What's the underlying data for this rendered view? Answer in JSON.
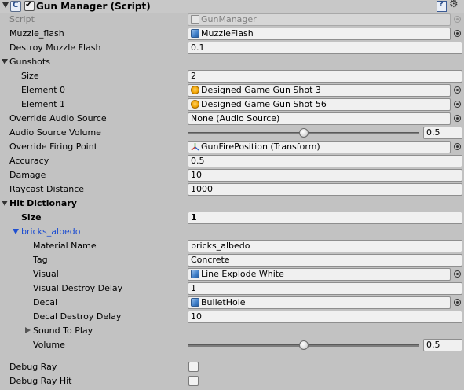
{
  "component": {
    "title": "Gun Manager (Script)"
  },
  "fields": {
    "script": {
      "label": "Script",
      "value": "GunManager"
    },
    "muzzle_flash": {
      "label": "Muzzle_flash",
      "value": "MuzzleFlash"
    },
    "destroy_muzzle_flash": {
      "label": "Destroy Muzzle Flash",
      "value": "0.1"
    },
    "gunshots": {
      "label": "Gunshots",
      "size_label": "Size",
      "size_value": "2",
      "elements": [
        {
          "label": "Element 0",
          "value": "Designed Game Gun Shot 3"
        },
        {
          "label": "Element 1",
          "value": "Designed Game Gun Shot 56"
        }
      ]
    },
    "override_audio_source": {
      "label": "Override Audio Source",
      "value": "None (Audio Source)"
    },
    "audio_source_volume": {
      "label": "Audio Source Volume",
      "value": "0.5",
      "level": 0.5
    },
    "override_firing_point": {
      "label": "Override Firing Point",
      "value": "GunFirePosition (Transform)"
    },
    "accuracy": {
      "label": "Accuracy",
      "value": "0.5"
    },
    "damage": {
      "label": "Damage",
      "value": "10"
    },
    "raycast_distance": {
      "label": "Raycast Distance",
      "value": "1000"
    },
    "hit_dictionary": {
      "label": "Hit Dictionary",
      "size_label": "Size",
      "size_value": "1",
      "entry": {
        "label": "bricks_albedo",
        "material_name": {
          "label": "Material Name",
          "value": "bricks_albedo"
        },
        "tag": {
          "label": "Tag",
          "value": "Concrete"
        },
        "visual": {
          "label": "Visual",
          "value": "Line Explode White"
        },
        "visual_destroy_delay": {
          "label": "Visual Destroy Delay",
          "value": "1"
        },
        "decal": {
          "label": "Decal",
          "value": "BulletHole"
        },
        "decal_destroy_delay": {
          "label": "Decal Destroy Delay",
          "value": "10"
        },
        "sound_to_play": {
          "label": "Sound To Play"
        },
        "volume": {
          "label": "Volume",
          "value": "0.5",
          "level": 0.5
        }
      }
    },
    "debug_ray": {
      "label": "Debug Ray",
      "checked": false
    },
    "debug_ray_hit": {
      "label": "Debug Ray Hit",
      "checked": false
    }
  },
  "icons": {
    "header_foldout": "triangle-down-icon",
    "script": "script-icon",
    "enable_checkbox": "checkbox-checked-icon",
    "help": "book-help-icon",
    "settings": "gear-icon",
    "prefab": "cube-icon",
    "audio_clip": "audio-clip-icon",
    "transform": "transform-icon",
    "object_picker": "object-picker-icon"
  },
  "colors": {
    "panel_bg": "#c2c2c2",
    "field_bg": "#f0f0f0",
    "selected_text": "#1f4fd1"
  }
}
